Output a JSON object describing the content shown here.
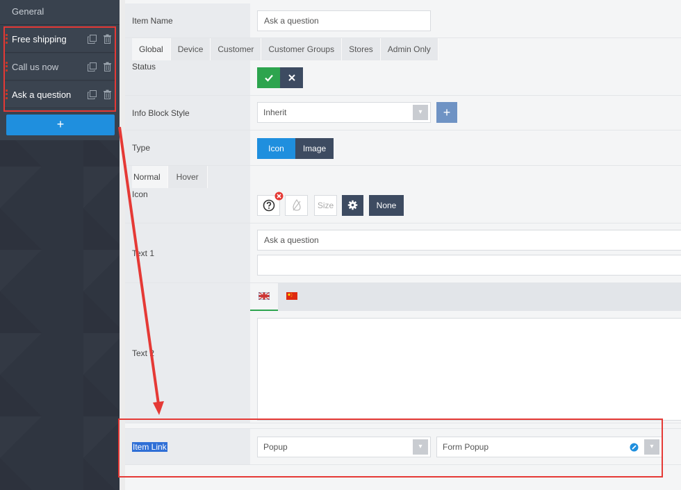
{
  "sidebar": {
    "general_label": "General",
    "items": [
      {
        "label": "Free shipping"
      },
      {
        "label": "Call us now"
      },
      {
        "label": "Ask a question"
      }
    ],
    "add_label": "+"
  },
  "form": {
    "item_name": {
      "label": "Item Name",
      "value": "Ask a question"
    },
    "status": {
      "label": "Status",
      "tabs": [
        "Global",
        "Device",
        "Customer",
        "Customer Groups",
        "Stores",
        "Admin Only"
      ]
    },
    "info_block_style": {
      "label": "Info Block Style",
      "value": "Inherit",
      "add_label": "+"
    },
    "type": {
      "label": "Type",
      "options": [
        "Icon",
        "Image"
      ],
      "selected": "Icon"
    },
    "icon": {
      "label": "Icon",
      "tabs": [
        "Normal",
        "Hover"
      ],
      "size_placeholder": "Size",
      "none_label": "None"
    },
    "text1": {
      "label": "Text 1",
      "value": "Ask a question",
      "value2": ""
    },
    "text2": {
      "label": "Text 2"
    },
    "item_link": {
      "label": "Item Link",
      "type_value": "Popup",
      "target_value": "Form Popup"
    }
  },
  "colors": {
    "accent_blue": "#1f8fde",
    "dark_button": "#3d4b61",
    "success_green": "#2da44e",
    "highlight_red": "#e53935"
  }
}
